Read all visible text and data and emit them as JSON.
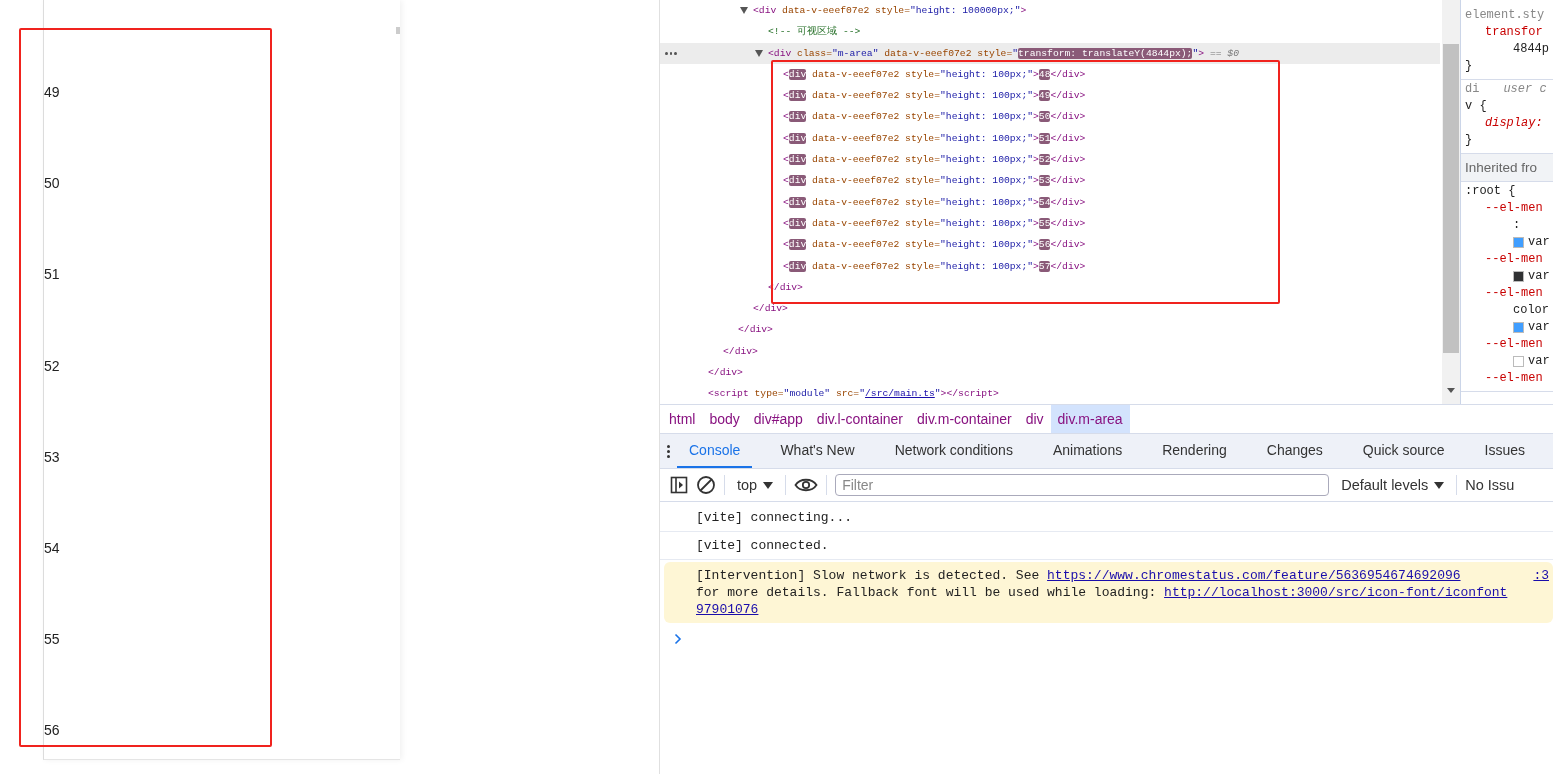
{
  "page": {
    "items": [
      "49",
      "50",
      "51",
      "52",
      "53",
      "54",
      "55",
      "56"
    ]
  },
  "elements": {
    "tree": [
      {
        "closing": [
          {
            "text": "</div>",
            "kind": "tag"
          }
        ],
        "children": [
          {
            "closing": [
              {
                "text": "</div>",
                "kind": "tag"
              }
            ],
            "children": [
              {
                "closing": [
                  {
                    "text": "</div>",
                    "kind": "tag"
                  }
                ],
                "children": [
                  {
                    "selected": false,
                    "expanded": true,
                    "tokens": [
                      {
                        "text": "<div",
                        "kind": "tag"
                      },
                      {
                        "text": " data-v-eeef07e2 style=",
                        "kind": "attr"
                      },
                      {
                        "text": "\"height: 100000px;\"",
                        "kind": "value"
                      },
                      {
                        "text": ">",
                        "kind": "tag"
                      }
                    ],
                    "closing": [
                      {
                        "text": "</div>",
                        "kind": "tag"
                      }
                    ],
                    "children": [
                      {
                        "selected": false,
                        "tokens": [
                          {
                            "text": "<!-- 可视区域 -->",
                            "kind": "comment"
                          }
                        ]
                      },
                      {
                        "selected": true,
                        "expanded": true,
                        "tokens": [
                          {
                            "text": "<div",
                            "kind": "tag"
                          },
                          {
                            "text": " class=",
                            "kind": "attr"
                          },
                          {
                            "text": "\"m-area\"",
                            "kind": "value"
                          },
                          {
                            "text": " data-v-eeef07e2 style=",
                            "kind": "attr"
                          },
                          {
                            "text": "\"",
                            "kind": "value"
                          },
                          {
                            "text": "transform: translateY(4844px);",
                            "kind": "match"
                          },
                          {
                            "text": "\"",
                            "kind": "value"
                          },
                          {
                            "text": ">",
                            "kind": "tag"
                          },
                          {
                            "text": " == $0",
                            "kind": "hint"
                          }
                        ],
                        "closing": [
                          {
                            "text": "</div>",
                            "kind": "tag"
                          }
                        ],
                        "children": [
                          {
                            "selected": false,
                            "tokens": [
                              {
                                "text": "<",
                                "kind": "tag"
                              },
                              {
                                "text": "div",
                                "kind": "match"
                              },
                              {
                                "text": " data-v-eeef07e2 style=",
                                "kind": "attr"
                              },
                              {
                                "text": "\"height: 100px;\"",
                                "kind": "value"
                              },
                              {
                                "text": ">",
                                "kind": "tag"
                              },
                              {
                                "text": "48",
                                "kind": "match"
                              },
                              {
                                "text": "</div>",
                                "kind": "tag"
                              }
                            ]
                          },
                          {
                            "selected": false,
                            "tokens": [
                              {
                                "text": "<",
                                "kind": "tag"
                              },
                              {
                                "text": "div",
                                "kind": "match"
                              },
                              {
                                "text": " data-v-eeef07e2 style=",
                                "kind": "attr"
                              },
                              {
                                "text": "\"height: 100px;\"",
                                "kind": "value"
                              },
                              {
                                "text": ">",
                                "kind": "tag"
                              },
                              {
                                "text": "49",
                                "kind": "match"
                              },
                              {
                                "text": "</div>",
                                "kind": "tag"
                              }
                            ]
                          },
                          {
                            "selected": false,
                            "tokens": [
                              {
                                "text": "<",
                                "kind": "tag"
                              },
                              {
                                "text": "div",
                                "kind": "match"
                              },
                              {
                                "text": " data-v-eeef07e2 style=",
                                "kind": "attr"
                              },
                              {
                                "text": "\"height: 100px;\"",
                                "kind": "value"
                              },
                              {
                                "text": ">",
                                "kind": "tag"
                              },
                              {
                                "text": "50",
                                "kind": "match"
                              },
                              {
                                "text": "</div>",
                                "kind": "tag"
                              }
                            ]
                          },
                          {
                            "selected": false,
                            "tokens": [
                              {
                                "text": "<",
                                "kind": "tag"
                              },
                              {
                                "text": "div",
                                "kind": "match"
                              },
                              {
                                "text": " data-v-eeef07e2 style=",
                                "kind": "attr"
                              },
                              {
                                "text": "\"height: 100px;\"",
                                "kind": "value"
                              },
                              {
                                "text": ">",
                                "kind": "tag"
                              },
                              {
                                "text": "51",
                                "kind": "match"
                              },
                              {
                                "text": "</div>",
                                "kind": "tag"
                              }
                            ]
                          },
                          {
                            "selected": false,
                            "tokens": [
                              {
                                "text": "<",
                                "kind": "tag"
                              },
                              {
                                "text": "div",
                                "kind": "match"
                              },
                              {
                                "text": " data-v-eeef07e2 style=",
                                "kind": "attr"
                              },
                              {
                                "text": "\"height: 100px;\"",
                                "kind": "value"
                              },
                              {
                                "text": ">",
                                "kind": "tag"
                              },
                              {
                                "text": "52",
                                "kind": "match"
                              },
                              {
                                "text": "</div>",
                                "kind": "tag"
                              }
                            ]
                          },
                          {
                            "selected": false,
                            "tokens": [
                              {
                                "text": "<",
                                "kind": "tag"
                              },
                              {
                                "text": "div",
                                "kind": "match"
                              },
                              {
                                "text": " data-v-eeef07e2 style=",
                                "kind": "attr"
                              },
                              {
                                "text": "\"height: 100px;\"",
                                "kind": "value"
                              },
                              {
                                "text": ">",
                                "kind": "tag"
                              },
                              {
                                "text": "53",
                                "kind": "match"
                              },
                              {
                                "text": "</div>",
                                "kind": "tag"
                              }
                            ]
                          },
                          {
                            "selected": false,
                            "tokens": [
                              {
                                "text": "<",
                                "kind": "tag"
                              },
                              {
                                "text": "div",
                                "kind": "match"
                              },
                              {
                                "text": " data-v-eeef07e2 style=",
                                "kind": "attr"
                              },
                              {
                                "text": "\"height: 100px;\"",
                                "kind": "value"
                              },
                              {
                                "text": ">",
                                "kind": "tag"
                              },
                              {
                                "text": "54",
                                "kind": "match"
                              },
                              {
                                "text": "</div>",
                                "kind": "tag"
                              }
                            ]
                          },
                          {
                            "selected": false,
                            "tokens": [
                              {
                                "text": "<",
                                "kind": "tag"
                              },
                              {
                                "text": "div",
                                "kind": "match"
                              },
                              {
                                "text": " data-v-eeef07e2 style=",
                                "kind": "attr"
                              },
                              {
                                "text": "\"height: 100px;\"",
                                "kind": "value"
                              },
                              {
                                "text": ">",
                                "kind": "tag"
                              },
                              {
                                "text": "55",
                                "kind": "match"
                              },
                              {
                                "text": "</div>",
                                "kind": "tag"
                              }
                            ]
                          },
                          {
                            "selected": false,
                            "tokens": [
                              {
                                "text": "<",
                                "kind": "tag"
                              },
                              {
                                "text": "div",
                                "kind": "match"
                              },
                              {
                                "text": " data-v-eeef07e2 style=",
                                "kind": "attr"
                              },
                              {
                                "text": "\"height: 100px;\"",
                                "kind": "value"
                              },
                              {
                                "text": ">",
                                "kind": "tag"
                              },
                              {
                                "text": "56",
                                "kind": "match"
                              },
                              {
                                "text": "</div>",
                                "kind": "tag"
                              }
                            ]
                          },
                          {
                            "selected": false,
                            "tokens": [
                              {
                                "text": "<",
                                "kind": "tag"
                              },
                              {
                                "text": "div",
                                "kind": "match"
                              },
                              {
                                "text": " data-v-eeef07e2 style=",
                                "kind": "attr"
                              },
                              {
                                "text": "\"height: 100px;\"",
                                "kind": "value"
                              },
                              {
                                "text": ">",
                                "kind": "tag"
                              },
                              {
                                "text": "57",
                                "kind": "match"
                              },
                              {
                                "text": "</div>",
                                "kind": "tag"
                              }
                            ]
                          }
                        ]
                      }
                    ]
                  }
                ]
              }
            ]
          }
        ]
      },
      {
        "selected": false,
        "tokens": [
          {
            "text": "<script",
            "kind": "tag"
          },
          {
            "text": " type=",
            "kind": "attr"
          },
          {
            "text": "\"module\"",
            "kind": "value"
          },
          {
            "text": " src=",
            "kind": "attr"
          },
          {
            "text": "\"",
            "kind": "value"
          },
          {
            "text": "/src/main.ts",
            "kind": "link"
          },
          {
            "text": "\"",
            "kind": "value"
          },
          {
            "text": ">",
            "kind": "tag"
          },
          {
            "text": "</script>",
            "kind": "tag"
          }
        ]
      }
    ]
  },
  "styles": {
    "sections": [
      {
        "kind": "rules",
        "lines": [
          {
            "kind": "selector",
            "text": "element.sty"
          },
          {
            "kind": "property",
            "text": "transfor"
          },
          {
            "kind": "value",
            "text": "4844p"
          },
          {
            "kind": "brace",
            "text": "}"
          }
        ]
      },
      {
        "kind": "rules",
        "lines": [
          {
            "kind": "selector",
            "text": "di",
            "origin": "user c"
          },
          {
            "kind": "brace",
            "text": "v {"
          },
          {
            "kind": "property-italic",
            "text": "display:"
          },
          {
            "kind": "brace",
            "text": "}"
          }
        ]
      },
      {
        "kind": "header",
        "lines": [
          {
            "kind": "header",
            "text": "Inherited fro"
          }
        ]
      },
      {
        "kind": "rules",
        "lines": [
          {
            "kind": "brace",
            "text": ":root {"
          },
          {
            "kind": "property",
            "text": "--el-men"
          },
          {
            "kind": "value",
            "text": ":"
          },
          {
            "kind": "swatch",
            "text": "var",
            "color": "#409eff"
          },
          {
            "kind": "property",
            "text": "--el-men"
          },
          {
            "kind": "swatch",
            "text": "var",
            "color": "#303133"
          },
          {
            "kind": "property",
            "text": "--el-men"
          },
          {
            "kind": "value",
            "text": "color"
          },
          {
            "kind": "swatch",
            "text": "var",
            "color": "#409eff"
          },
          {
            "kind": "property",
            "text": "--el-men"
          },
          {
            "kind": "swatch",
            "text": "var",
            "color": "#ffffff"
          },
          {
            "kind": "property",
            "text": "--el-men"
          }
        ]
      }
    ]
  },
  "breadcrumbs": [
    {
      "label": "html",
      "selected": false
    },
    {
      "label": "body",
      "selected": false
    },
    {
      "label": "div#app",
      "selected": false
    },
    {
      "label": "div.l-container",
      "selected": false
    },
    {
      "label": "div.m-container",
      "selected": false
    },
    {
      "label": "div",
      "selected": false
    },
    {
      "label": "div.m-area",
      "selected": true
    }
  ],
  "drawer_tabs": [
    {
      "label": "Console",
      "selected": true
    },
    {
      "label": "What's New",
      "selected": false
    },
    {
      "label": "Network conditions",
      "selected": false
    },
    {
      "label": "Animations",
      "selected": false
    },
    {
      "label": "Rendering",
      "selected": false
    },
    {
      "label": "Changes",
      "selected": false
    },
    {
      "label": "Quick source",
      "selected": false
    },
    {
      "label": "Issues",
      "selected": false
    }
  ],
  "console_toolbar": {
    "context": "top",
    "filter": {
      "placeholder": "Filter"
    },
    "levels": "Default levels",
    "issues": "No Issu"
  },
  "console": {
    "messages": [
      {
        "kind": "log",
        "lines": [
          [
            {
              "kind": "text",
              "text": "[vite] connecting..."
            }
          ]
        ]
      },
      {
        "kind": "log",
        "lines": [
          [
            {
              "kind": "text",
              "text": "[vite] connected."
            }
          ]
        ]
      },
      {
        "kind": "warning",
        "source": ":3",
        "lines": [
          [
            {
              "kind": "text",
              "text": "[Intervention] Slow network is detected. See "
            },
            {
              "kind": "link",
              "text": "https://www.chromestatus.com/feature/5636954674692096"
            }
          ],
          [
            {
              "kind": "text",
              "text": "for more details. Fallback font will be used while loading: "
            },
            {
              "kind": "link",
              "text": "http://localhost:3000/src/icon-font/iconfont"
            }
          ],
          [
            {
              "kind": "link",
              "text": "97901076"
            }
          ]
        ]
      }
    ]
  }
}
